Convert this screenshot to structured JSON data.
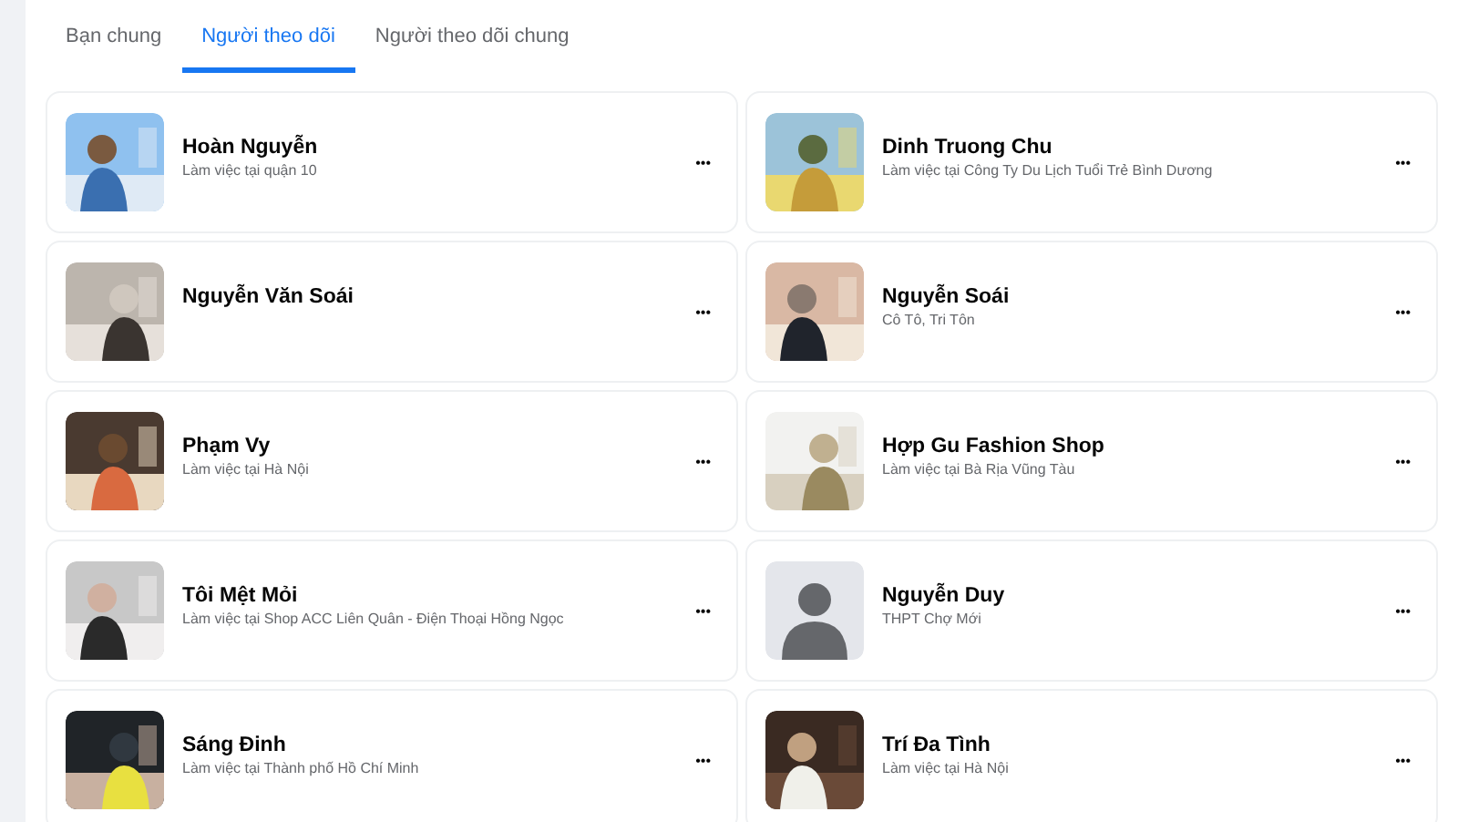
{
  "tabs": [
    {
      "label": "Bạn chung",
      "selected": false
    },
    {
      "label": "Người theo dõi",
      "selected": true
    },
    {
      "label": "Người theo dõi chung",
      "selected": false
    }
  ],
  "people": [
    {
      "name": "Hoàn Nguyễn",
      "detail": "Làm việc tại quận 10",
      "menu": "•••"
    },
    {
      "name": "Dinh Truong Chu",
      "detail": "Làm việc tại Công Ty Du Lịch Tuổi Trẻ Bình Dương",
      "menu": "•••"
    },
    {
      "name": "Nguyễn Văn Soái",
      "menu": "•••"
    },
    {
      "name": "Nguyễn Soái",
      "detail": "Cô Tô, Tri Tôn",
      "menu": "•••"
    },
    {
      "name": "Phạm Vy",
      "detail": "Làm việc tại Hà Nội",
      "menu": "•••"
    },
    {
      "name": "Hợp Gu Fashion Shop",
      "detail": "Làm việc tại Bà Rịa Vũng Tàu",
      "menu": "•••"
    },
    {
      "name": "Tôi Mệt Mỏi",
      "detail": "Làm việc tại Shop ACC Liên Quân - Điện Thoại Hồng Ngọc",
      "menu": "•••"
    },
    {
      "name": "Nguyễn Duy",
      "detail": "THPT Chợ Mới",
      "avatar": {
        "kind": "default"
      },
      "menu": "•••"
    },
    {
      "name": "Sáng Đinh",
      "detail": "Làm việc tại Thành phố Hồ Chí Minh",
      "menu": "•••"
    },
    {
      "name": "Trí Đa Tình",
      "detail": "Làm việc tại Hà Nội",
      "menu": "•••"
    }
  ]
}
